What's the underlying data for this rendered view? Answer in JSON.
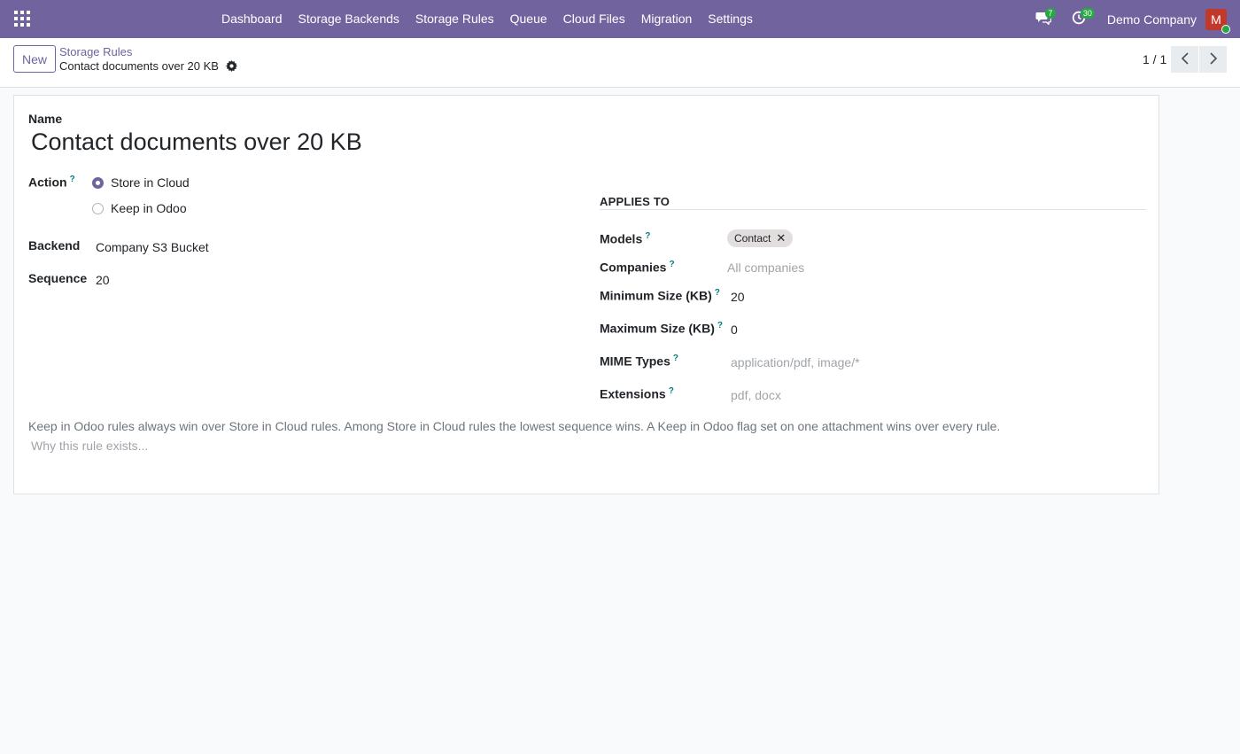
{
  "navbar": {
    "menu": [
      "Dashboard",
      "Storage Backends",
      "Storage Rules",
      "Queue",
      "Cloud Files",
      "Migration",
      "Settings"
    ],
    "messages_count": "7",
    "activities_count": "30",
    "company": "Demo Company",
    "avatar_initial": "M",
    "color": "#71639e"
  },
  "control_panel": {
    "new_label": "New",
    "breadcrumb_parent": "Storage Rules",
    "breadcrumb_current": "Contact documents over 20 KB",
    "pager": "1 / 1"
  },
  "form": {
    "name_label": "Name",
    "name_value": "Contact documents over 20 KB",
    "action_label": "Action",
    "action_help": "?",
    "action_options": [
      "Store in Cloud",
      "Keep in Odoo"
    ],
    "action_selected": "Store in Cloud",
    "backend_label": "Backend",
    "backend_value": "Company S3 Bucket",
    "sequence_label": "Sequence",
    "sequence_value": "20",
    "applies_to": {
      "title": "APPLIES TO",
      "models_label": "Models",
      "models_tags": [
        "Contact"
      ],
      "companies_label": "Companies",
      "companies_placeholder": "All companies",
      "min_size_label": "Minimum Size (KB)",
      "min_size_value": "20",
      "max_size_label": "Maximum Size (KB)",
      "max_size_value": "0",
      "mime_label": "MIME Types",
      "mime_placeholder": "application/pdf, image/*",
      "ext_label": "Extensions",
      "ext_placeholder": "pdf, docx"
    },
    "help_text": "Keep in Odoo rules always win over Store in Cloud rules. Among Store in Cloud rules the lowest sequence wins. A Keep in Odoo flag set on one attachment wins over every rule.",
    "notes_placeholder": "Why this rule exists..."
  }
}
